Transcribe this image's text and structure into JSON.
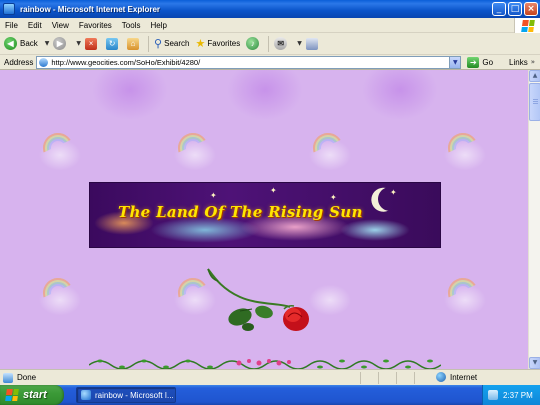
{
  "window": {
    "title": "rainbow - Microsoft Internet Explorer",
    "buttons": {
      "minimize": "_",
      "maximize": "□",
      "close": "×"
    }
  },
  "menu": [
    "File",
    "Edit",
    "View",
    "Favorites",
    "Tools",
    "Help"
  ],
  "toolbar": {
    "back_label": "Back",
    "search_label": "Search",
    "favorites_label": "Favorites"
  },
  "address": {
    "label": "Address",
    "url": "http://www.geocities.com/SoHo/Exhibit/4280/",
    "go_label": "Go",
    "links_label": "Links"
  },
  "page": {
    "banner_title": "The Land Of The Rising Sun",
    "background_color": "#d7b3ee"
  },
  "status": {
    "text": "Done",
    "zone": "Internet"
  },
  "taskbar": {
    "start_label": "start",
    "task_label": "rainbow - Microsoft I...",
    "clock": "2:37 PM"
  },
  "icons": [
    "ie-icon",
    "back-icon",
    "forward-icon",
    "stop-icon",
    "refresh-icon",
    "home-icon",
    "search-icon",
    "favorites-icon",
    "media-icon",
    "mail-icon",
    "print-icon",
    "go-icon",
    "globe-icon",
    "windows-flag-icon"
  ]
}
